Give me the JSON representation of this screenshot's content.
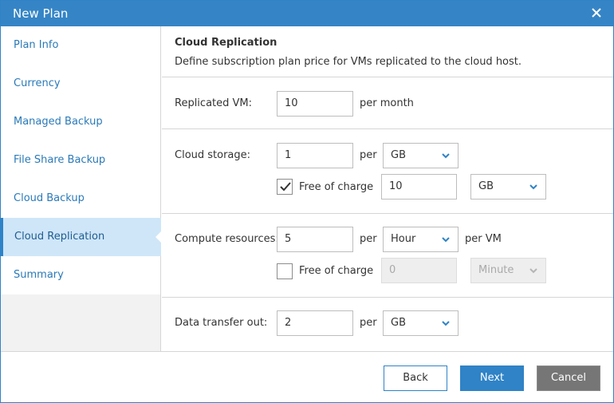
{
  "window": {
    "title": "New Plan"
  },
  "sidebar": {
    "items": [
      {
        "label": "Plan Info"
      },
      {
        "label": "Currency"
      },
      {
        "label": "Managed Backup"
      },
      {
        "label": "File Share Backup"
      },
      {
        "label": "Cloud Backup"
      },
      {
        "label": "Cloud Replication"
      },
      {
        "label": "Summary"
      }
    ],
    "active": "Cloud Replication"
  },
  "header": {
    "title": "Cloud Replication",
    "description": "Define subscription plan price for VMs replicated to the cloud host."
  },
  "replicated_vm": {
    "label": "Replicated VM:",
    "value": "10",
    "suffix": "per month"
  },
  "cloud_storage": {
    "label": "Cloud storage:",
    "value": "1",
    "per": "per",
    "unit": "GB",
    "free": {
      "checked": true,
      "label": "Free of charge",
      "value": "10",
      "unit": "GB"
    }
  },
  "compute": {
    "label": "Compute resources:",
    "value": "5",
    "per": "per",
    "unit": "Hour",
    "suffix": "per VM",
    "free": {
      "checked": false,
      "label": "Free of charge",
      "value": "0",
      "unit": "Minute"
    }
  },
  "data_transfer": {
    "label": "Data transfer out:",
    "value": "2",
    "per": "per",
    "unit": "GB"
  },
  "footer": {
    "back": "Back",
    "next": "Next",
    "cancel": "Cancel"
  },
  "colors": {
    "accent": "#2f83c6",
    "titlebar": "#3585c6",
    "active_nav": "#cfe6f9",
    "cancel": "#767676"
  }
}
